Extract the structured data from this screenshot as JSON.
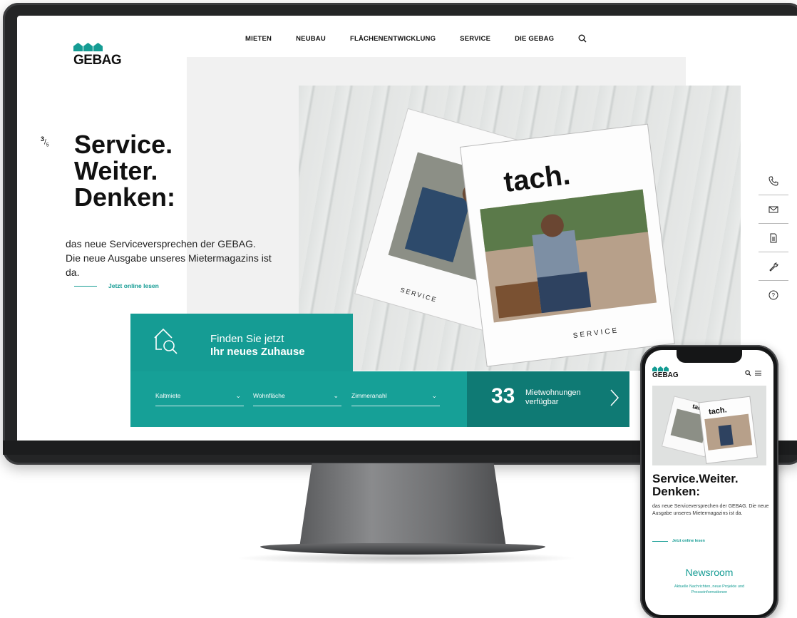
{
  "logo": {
    "text": "GEBAG"
  },
  "nav": {
    "items": [
      "MIETEN",
      "NEUBAU",
      "FLÄCHENENTWICKLUNG",
      "SERVICE",
      "DIE GEBAG"
    ]
  },
  "slide": {
    "current": "3",
    "total": "5"
  },
  "hero": {
    "headline": [
      "Service.",
      "Weiter.",
      "Denken:"
    ],
    "subtext": "das neue Serviceversprechen der GEBAG. Die neue Ausgabe unseres Mietermagazins ist da.",
    "link": "Jetzt online lesen",
    "magazine_title": "tach.",
    "magazine_label": "SERVICE"
  },
  "finder": {
    "line1": "Finden Sie jetzt",
    "line2": "Ihr neues Zuhause",
    "filters": [
      "Kaltmiete",
      "Wohnfläche",
      "Zimmeranahl"
    ],
    "count": "33",
    "count_label_1": "Mietwohnungen",
    "count_label_2": "verfügbar"
  },
  "side_icons": [
    "phone-icon",
    "mail-icon",
    "document-icon",
    "wrench-icon",
    "help-icon"
  ],
  "mobile": {
    "logo": "GEBAG",
    "headline_1": "Service.Weiter.",
    "headline_2": "Denken:",
    "subtext": "das neue Serviceversprechen der GEBAG. Die neue Ausgabe unseres Mietermagazins ist da.",
    "link": "Jetzt online lesen",
    "news_title": "Newsroom",
    "news_sub": "Aktuelle Nachrichten, neue Projekte und Presseinformationen"
  },
  "colors": {
    "brand": "#159c94",
    "brand_dark": "#0f7a74"
  }
}
